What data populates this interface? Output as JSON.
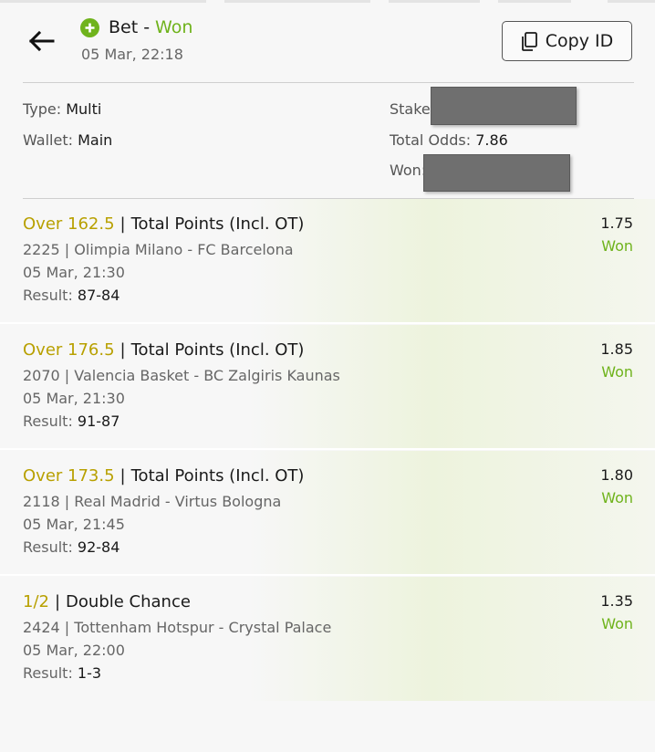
{
  "header": {
    "title_prefix": "Bet",
    "title_sep": "-",
    "title_status": "Won",
    "datetime": "05 Mar, 22:18",
    "copy_label": "Copy ID"
  },
  "info": {
    "type_label": "Type:",
    "type_value": "Multi",
    "wallet_label": "Wallet:",
    "wallet_value": "Main",
    "stake_label": "Stake",
    "total_odds_label": "Total Odds:",
    "total_odds_value": "7.86",
    "won_label": "Won:"
  },
  "selections": [
    {
      "pick": "Over 162.5",
      "market": "Total Points (Incl. OT)",
      "event": "2225 | Olimpia Milano - FC Barcelona",
      "time": "05 Mar, 21:30",
      "result_label": "Result:",
      "result": "87-84",
      "odds": "1.75",
      "status": "Won"
    },
    {
      "pick": "Over 176.5",
      "market": "Total Points (Incl. OT)",
      "event": "2070 | Valencia Basket - BC Zalgiris Kaunas",
      "time": "05 Mar, 21:30",
      "result_label": "Result:",
      "result": "91-87",
      "odds": "1.85",
      "status": "Won"
    },
    {
      "pick": "Over 173.5",
      "market": "Total Points (Incl. OT)",
      "event": "2118 | Real Madrid - Virtus Bologna",
      "time": "05 Mar, 21:45",
      "result_label": "Result:",
      "result": "92-84",
      "odds": "1.80",
      "status": "Won"
    },
    {
      "pick": "1/2",
      "market": "Double Chance",
      "event": "2424 | Tottenham Hotspur - Crystal Palace",
      "time": "05 Mar, 22:00",
      "result_label": "Result:",
      "result": "1-3",
      "odds": "1.35",
      "status": "Won"
    }
  ],
  "colors": {
    "accent_green": "#6fb31c",
    "pick_gold": "#b8a000",
    "redaction_gray": "#6f6f6f"
  }
}
